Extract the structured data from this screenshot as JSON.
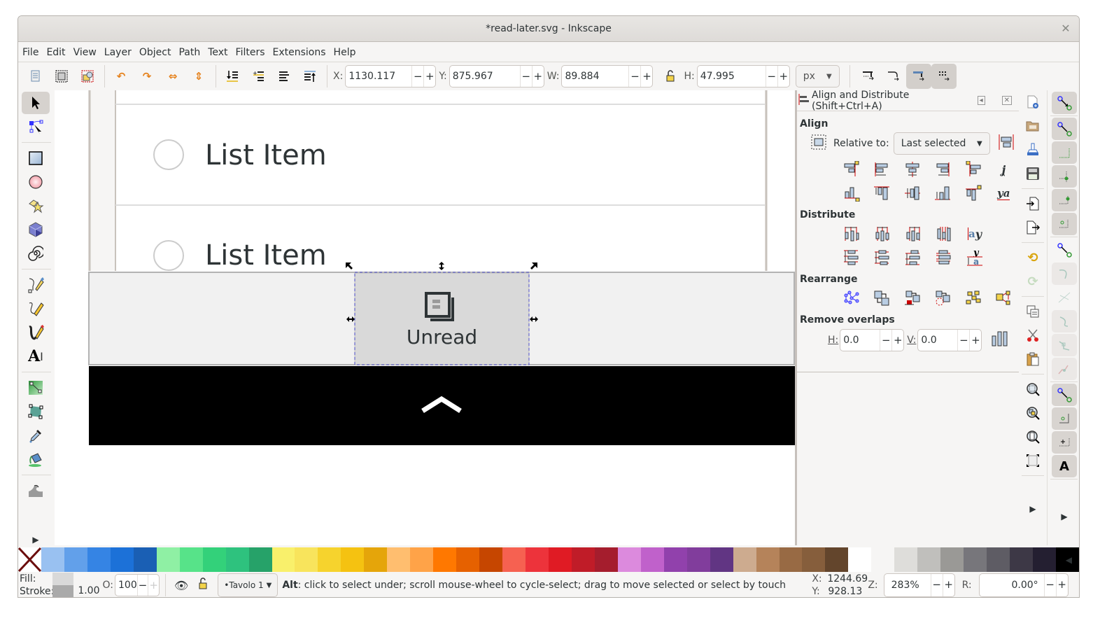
{
  "window": {
    "title": "*read-later.svg - Inkscape",
    "close_icon": "close-icon"
  },
  "menu": [
    "File",
    "Edit",
    "View",
    "Layer",
    "Object",
    "Path",
    "Text",
    "Filters",
    "Extensions",
    "Help"
  ],
  "toolbar": {
    "x_label": "X:",
    "x_value": "1130.117",
    "y_label": "Y:",
    "y_value": "875.967",
    "w_label": "W:",
    "w_value": "89.884",
    "h_label": "H:",
    "h_value": "47.995",
    "unit": "px",
    "minus": "−",
    "plus": "+"
  },
  "canvas": {
    "list_items": [
      "List Item",
      "List Item"
    ],
    "selected_button_label": "Unread"
  },
  "panel": {
    "title": "Align and Distribute (Shift+Ctrl+A)",
    "align_heading": "Align",
    "relative_label": "Relative to:",
    "relative_value": "Last selected",
    "distribute_heading": "Distribute",
    "rearrange_heading": "Rearrange",
    "overlaps_heading": "Remove overlaps",
    "h_label": "H:",
    "h_value": "0.0",
    "v_label": "V:",
    "v_value": "0.0"
  },
  "palette": [
    "#99c1f1",
    "#62a0ea",
    "#3584e4",
    "#1c71d8",
    "#1a5fb4",
    "#8ff0a4",
    "#57e389",
    "#33d17a",
    "#2ec27e",
    "#26a269",
    "#f9f06b",
    "#f8e45c",
    "#f6d32d",
    "#f5c211",
    "#e5a50a",
    "#ffbe6f",
    "#ffa348",
    "#ff7800",
    "#e66100",
    "#c64600",
    "#f66151",
    "#ed333b",
    "#e01b24",
    "#c01c28",
    "#a51d2d",
    "#dc8add",
    "#c061cb",
    "#9141ac",
    "#813d9c",
    "#613583",
    "#cdab8f",
    "#b5835a",
    "#986a44",
    "#865e3c",
    "#63452c",
    "#ffffff",
    "#f6f5f4",
    "#deddda",
    "#c0bfbc",
    "#9a9996",
    "#77767b",
    "#5e5c64",
    "#3d3846",
    "#241f31",
    "#000000"
  ],
  "status": {
    "fill_label": "Fill:",
    "stroke_label": "Stroke:",
    "stroke_width": "1.00",
    "opacity_label": "O:",
    "opacity_value": "100",
    "layer": "•Tavolo 1",
    "hint_key": "Alt",
    "hint_text": ": click to select under; scroll mouse-wheel to cycle-select; drag to move selected or select by touch",
    "cursor_x_label": "X:",
    "cursor_x": "1244.69",
    "cursor_y_label": "Y:",
    "cursor_y": "928.13",
    "zoom_label": "Z:",
    "zoom_value": "283%",
    "rotate_label": "R:",
    "rotate_value": "0.00°"
  }
}
